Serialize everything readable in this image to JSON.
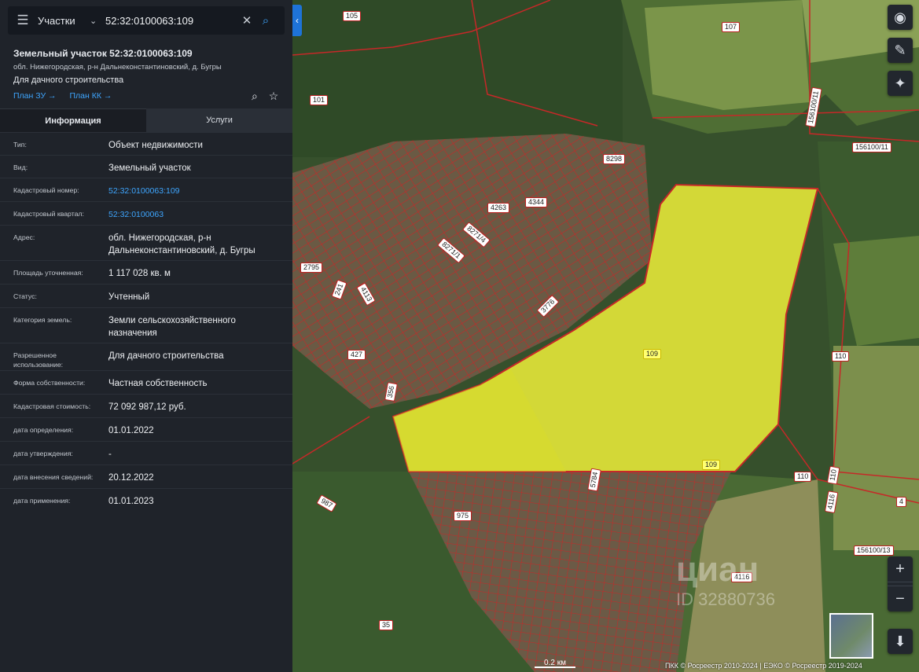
{
  "search": {
    "category": "Участки",
    "query": "52:32:0100063:109"
  },
  "object": {
    "title": "Земельный участок 52:32:0100063:109",
    "address_short": "обл. Нижегородская, р-н Дальнеконстантиновский, д. Бугры",
    "permitted_use": "Для дачного строительства",
    "link_plan_zu": "План ЗУ →",
    "link_plan_kk": "План КК →"
  },
  "tabs": {
    "info": "Информация",
    "services": "Услуги"
  },
  "rows": [
    {
      "label": "Тип:",
      "value": "Объект недвижимости",
      "link": false
    },
    {
      "label": "Вид:",
      "value": "Земельный участок",
      "link": false
    },
    {
      "label": "Кадастровый номер:",
      "value": "52:32:0100063:109",
      "link": true
    },
    {
      "label": "Кадастровый квартал:",
      "value": "52:32:0100063",
      "link": true
    },
    {
      "label": "Адрес:",
      "value": "обл. Нижегородская, р-н Дальнеконстантиновский, д. Бугры",
      "link": false
    },
    {
      "label": "Площадь уточненная:",
      "value": "1 117 028 кв. м",
      "link": false
    },
    {
      "label": "Статус:",
      "value": "Учтенный",
      "link": false
    },
    {
      "label": "Категория земель:",
      "value": "Земли сельскохозяйственного назначения",
      "link": false
    },
    {
      "label": "Разрешенное использование:",
      "value": "Для дачного строительства",
      "link": false
    },
    {
      "label": "Форма собственности:",
      "value": "Частная собственность",
      "link": false
    },
    {
      "label": "Кадастровая стоимость:",
      "value": "72 092 987,12 руб.",
      "link": false
    },
    {
      "label": "дата определения:",
      "value": "01.01.2022",
      "link": false
    },
    {
      "label": "дата утверждения:",
      "value": "-",
      "link": false
    },
    {
      "label": "дата внесения сведений:",
      "value": "20.12.2022",
      "link": false
    },
    {
      "label": "дата применения:",
      "value": "01.01.2023",
      "link": false
    }
  ],
  "map": {
    "labels": [
      "105",
      "107",
      "101",
      "156100/11",
      "156100/11",
      "8298",
      "4344",
      "4263",
      "8271/4",
      "8271/1",
      "2795",
      "241",
      "4113",
      "3776",
      "109",
      "109",
      "427",
      "356",
      "110",
      "110",
      "110",
      "4116",
      "4116",
      "4",
      "156100/13",
      "975",
      "987",
      "5784",
      "35"
    ],
    "scale": "0.2 км",
    "copyright": "ПКК © Росреестр 2010-2024 | ЕЭКО © Росреестр 2019-2024",
    "watermark": "циан",
    "watermark_id": "ID 32880736"
  },
  "colors": {
    "panel_bg": "#1f232a",
    "accent": "#3ea6ff",
    "parcel_line": "#c62828",
    "selected_fill": "#f2f22a"
  },
  "icons": {
    "menu": "hamburger-icon",
    "search": "search-icon",
    "clear": "close-icon",
    "zoom_in": "plus-icon",
    "zoom_out": "minus-icon"
  }
}
